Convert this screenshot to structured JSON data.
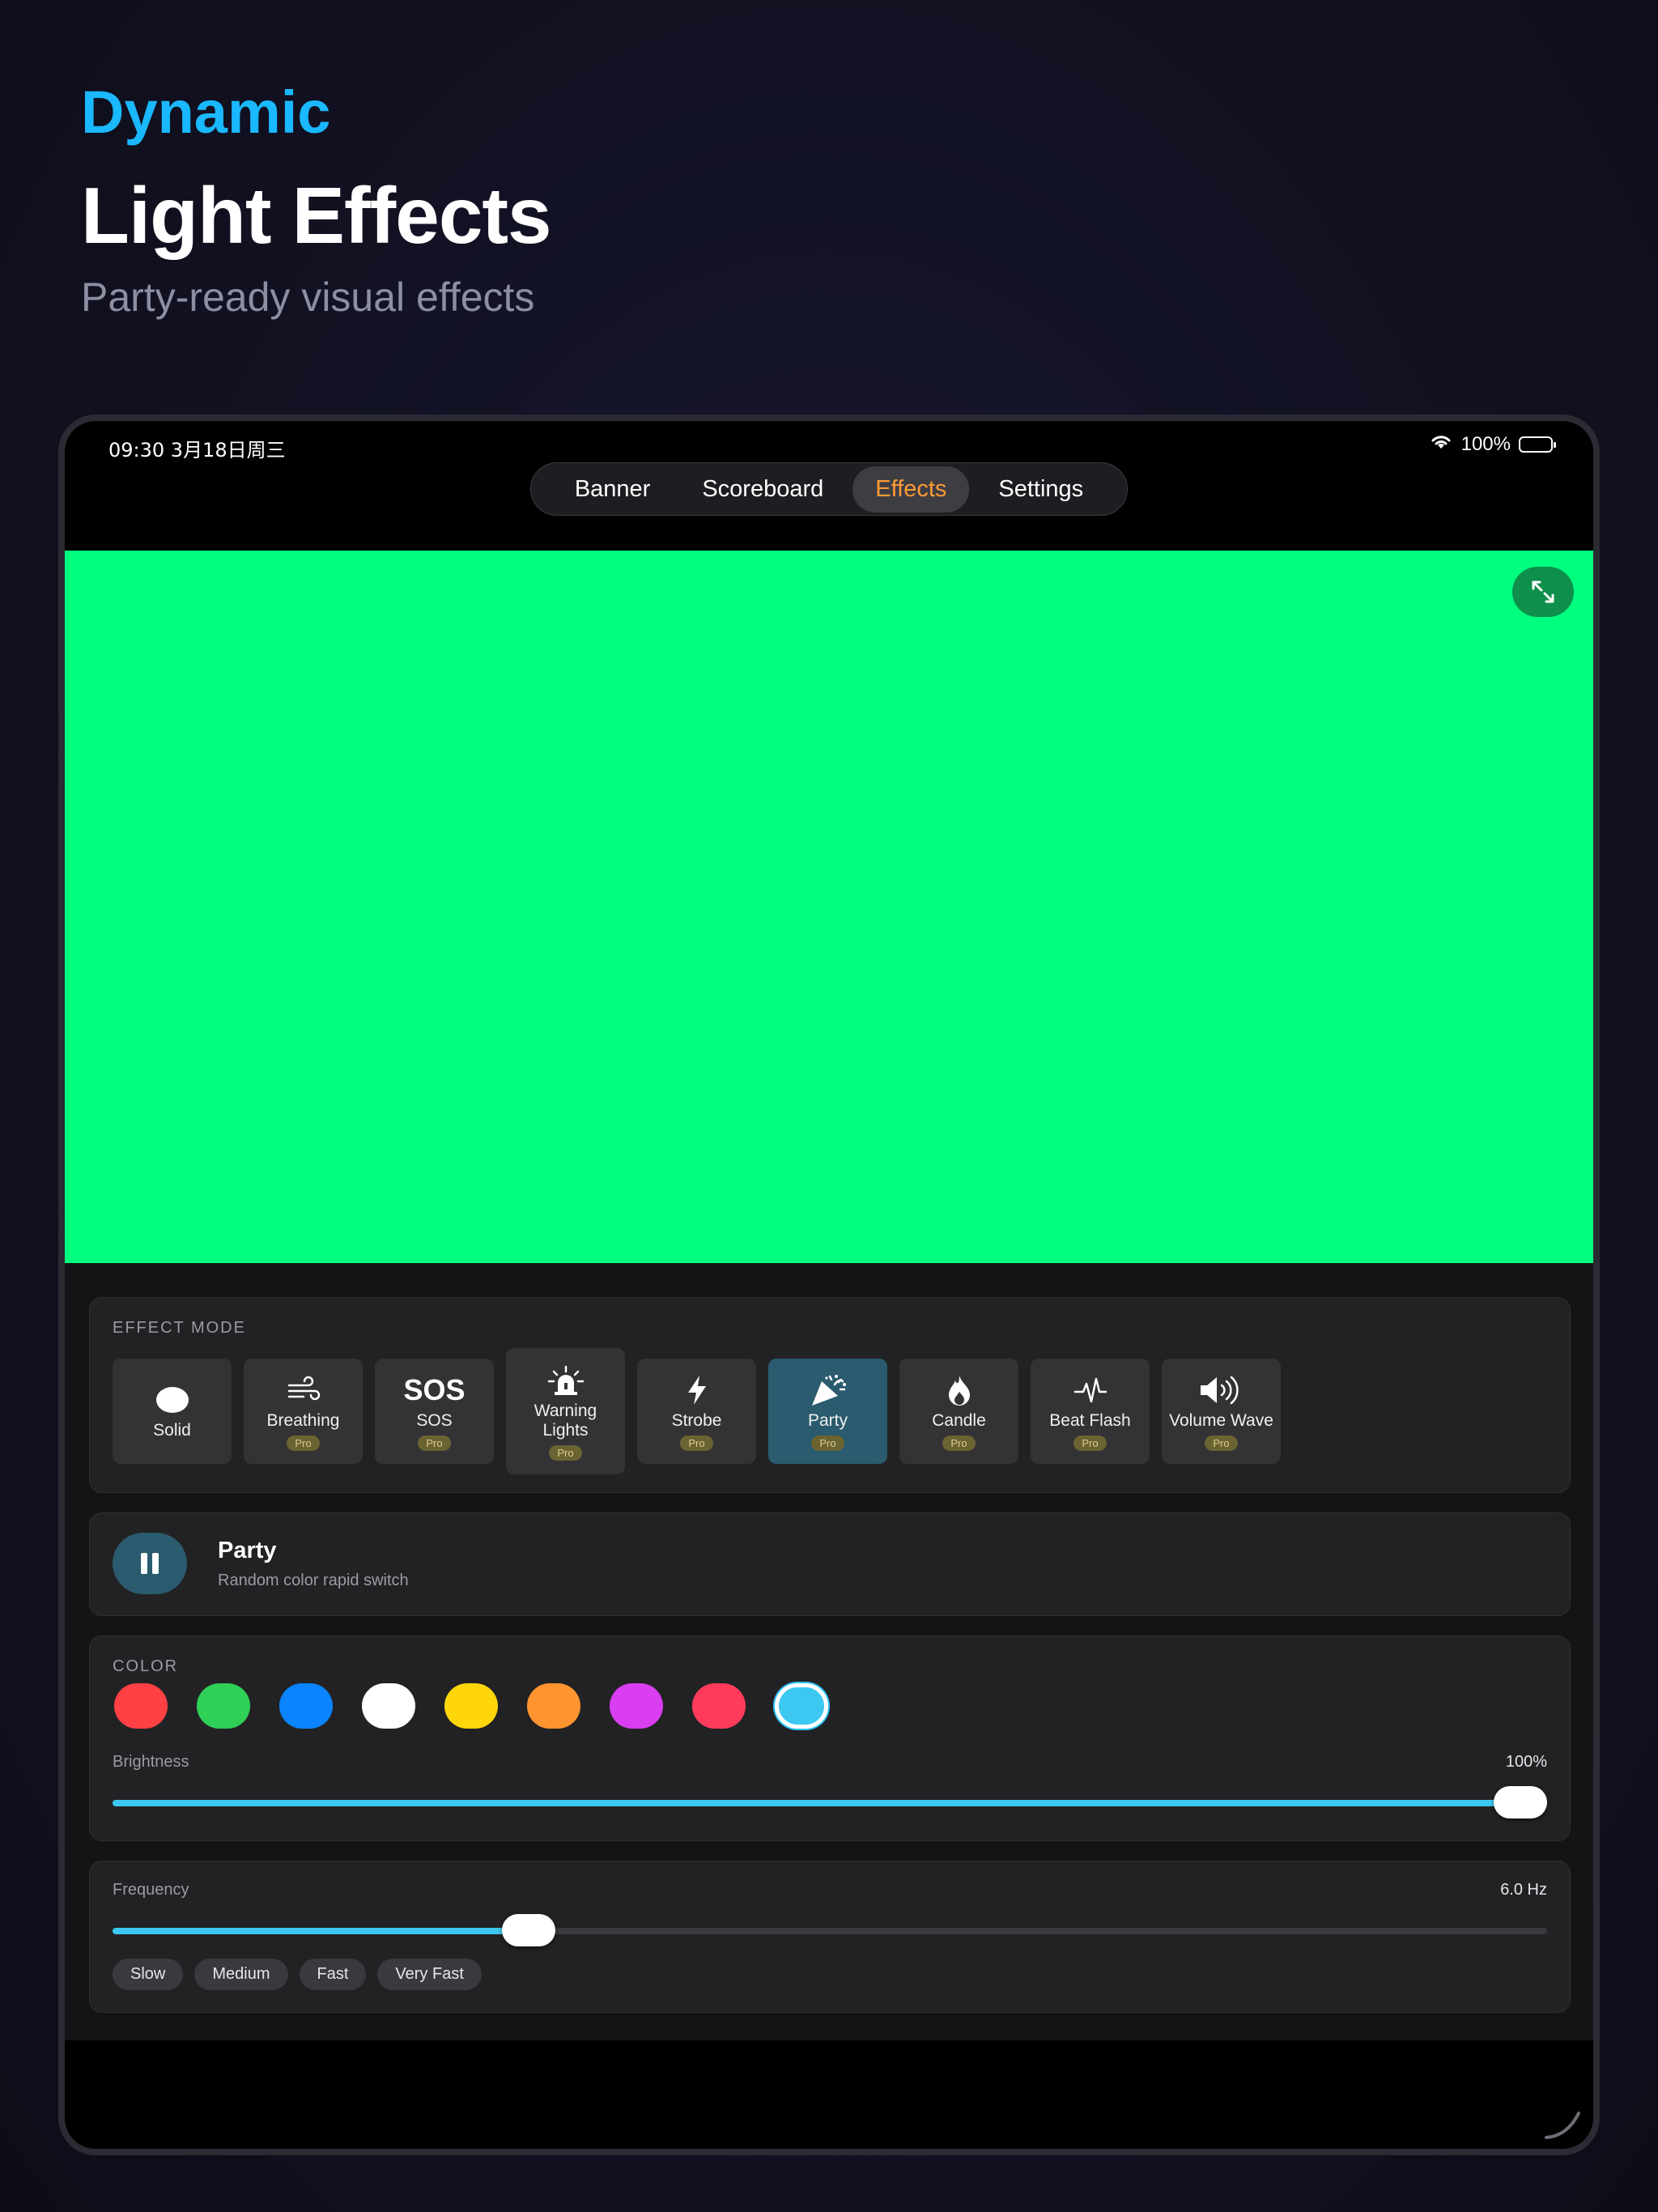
{
  "hero": {
    "kicker": "Dynamic",
    "title": "Light Effects",
    "subtitle": "Party-ready visual effects"
  },
  "status_bar": {
    "time": "09:30  3月18日周三",
    "battery": "100%"
  },
  "nav": {
    "tabs": [
      {
        "label": "Banner"
      },
      {
        "label": "Scoreboard"
      },
      {
        "label": "Effects"
      },
      {
        "label": "Settings"
      }
    ],
    "active": "Effects"
  },
  "preview": {
    "color": "#00ff7f"
  },
  "effect_mode": {
    "label": "EFFECT MODE",
    "pro_label": "Pro",
    "modes": [
      {
        "label": "Solid",
        "icon": "circle-icon",
        "pro": false
      },
      {
        "label": "Breathing",
        "icon": "wind-icon",
        "pro": true
      },
      {
        "label": "SOS",
        "icon": "sos-icon",
        "icon_text": "SOS",
        "pro": true
      },
      {
        "label": "Warning Lights",
        "icon": "siren-icon",
        "pro": true
      },
      {
        "label": "Strobe",
        "icon": "bolt-icon",
        "pro": true
      },
      {
        "label": "Party",
        "icon": "party-popper-icon",
        "pro": true,
        "active": true
      },
      {
        "label": "Candle",
        "icon": "flame-icon",
        "pro": true
      },
      {
        "label": "Beat Flash",
        "icon": "waveform-icon",
        "pro": true
      },
      {
        "label": "Volume Wave",
        "icon": "speaker-wave-icon",
        "pro": true
      }
    ]
  },
  "now_playing": {
    "title": "Party",
    "description": "Random color rapid switch"
  },
  "color": {
    "label": "COLOR",
    "swatches": [
      "#ff4045",
      "#2fcf58",
      "#0a84ff",
      "#ffffff",
      "#ffd60a",
      "#ff9430",
      "#d93ef0",
      "#ff3b5c",
      "#3cc8f0"
    ],
    "selected_index": 8
  },
  "brightness": {
    "label": "Brightness",
    "value": "100%",
    "fraction": 1.0
  },
  "frequency": {
    "label": "Frequency",
    "value": "6.0 Hz",
    "fraction": 0.29,
    "presets": [
      "Slow",
      "Medium",
      "Fast",
      "Very Fast"
    ]
  }
}
